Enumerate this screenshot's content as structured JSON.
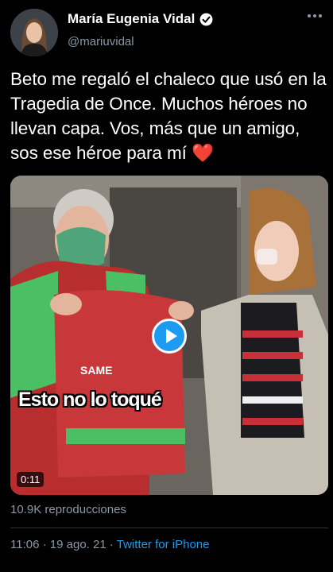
{
  "author": {
    "display_name": "María Eugenia Vidal",
    "handle": "@mariuvidal",
    "verified_icon": "verified-badge-icon",
    "avatar_icon": "profile-avatar"
  },
  "tweet": {
    "text": "Beto me regaló el chaleco que usó en la Tragedia de Once. Muchos héroes no llevan capa. Vos, más que un amigo, sos ese héroe para mí",
    "emoji": "❤️"
  },
  "video": {
    "caption": "Esto no lo toqué",
    "duration": "0:11",
    "vest_label": "SAME",
    "play_icon": "play-icon"
  },
  "stats": {
    "views": "10.9K reproducciones"
  },
  "meta": {
    "time": "11:06",
    "separator": " · ",
    "date": "19 ago. 21",
    "source": "Twitter for iPhone"
  },
  "colors": {
    "background": "#000000",
    "text": "#ffffff",
    "secondary": "#8b98a5",
    "accent": "#1d9bf0",
    "heart": "#e0245e"
  }
}
